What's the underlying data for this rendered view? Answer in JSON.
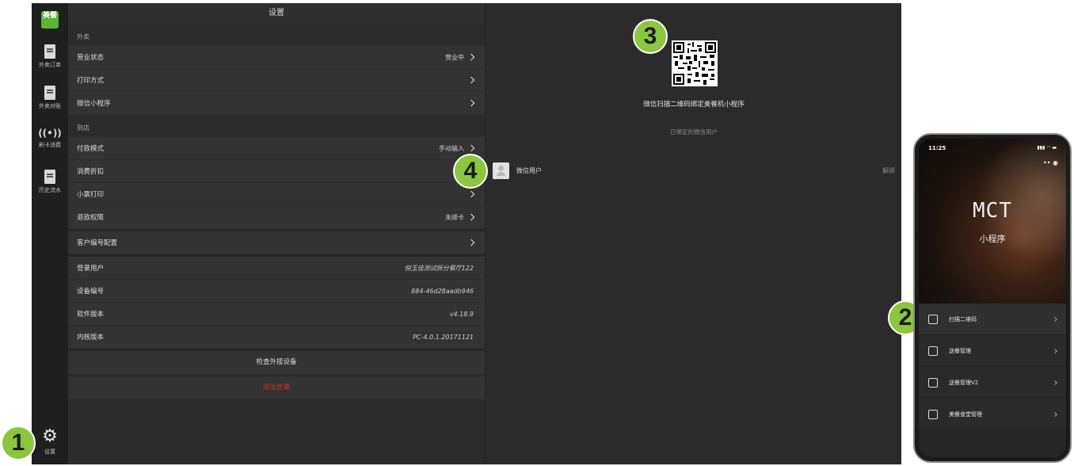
{
  "sidebar": {
    "logo": "美餐",
    "items": [
      {
        "label": "外卖订单"
      },
      {
        "label": "外卖对账"
      },
      {
        "label": "刷卡消费"
      },
      {
        "label": "历史流水"
      }
    ],
    "settings_label": "设置"
  },
  "settings": {
    "title": "设置",
    "section_takeout": "外卖",
    "takeout_rows": [
      {
        "label": "营业状态",
        "value": "营业中"
      },
      {
        "label": "打印方式",
        "value": ""
      },
      {
        "label": "微信小程序",
        "value": ""
      }
    ],
    "section_store": "到店",
    "store_rows": [
      {
        "label": "付款模式",
        "value": "手动输入"
      },
      {
        "label": "消费折扣",
        "value": ""
      },
      {
        "label": "小票打印",
        "value": ""
      },
      {
        "label": "退款权限",
        "value": "未绑卡"
      }
    ],
    "customer_code": "客户编号配置",
    "info_rows": [
      {
        "label": "登录用户",
        "value": "倪玉佳测试拆分餐厅122"
      },
      {
        "label": "设备编号",
        "value": "884-46d28aadb946"
      },
      {
        "label": "软件版本",
        "value": "v4.18.9"
      },
      {
        "label": "内核版本",
        "value": "PC-4.0.1.20171121"
      }
    ],
    "check_devices": "检查外接设备",
    "logout": "退出登录"
  },
  "wechat": {
    "qr_caption": "微信扫描二维码绑定美餐机小程序",
    "bound_title": "已绑定的微信用户",
    "user_name": "微信用户",
    "unbind": "解绑"
  },
  "badges": [
    "1",
    "2",
    "3",
    "4"
  ],
  "phone": {
    "time": "11:25",
    "hero_title": "MCT",
    "hero_subtitle": "小程序",
    "menu": [
      {
        "label": "扫描二维码"
      },
      {
        "label": "送餐管理"
      },
      {
        "label": "送餐管理V2"
      },
      {
        "label": "美餐食堂管理"
      }
    ]
  },
  "colors": {
    "accent_green": "#8cc63f",
    "brand_green": "#5bb434",
    "logout_red": "#c0392b"
  }
}
